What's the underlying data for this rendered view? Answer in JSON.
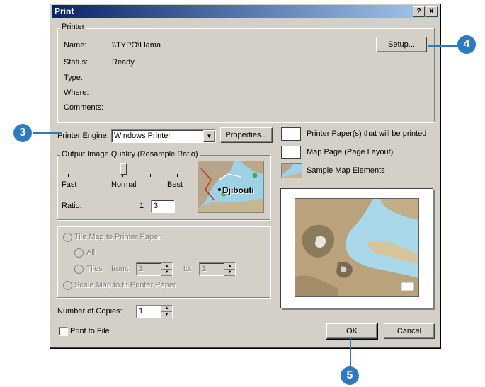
{
  "window": {
    "title": "Print",
    "help_btn": "?",
    "close_btn": "X"
  },
  "printer": {
    "group_title": "Printer",
    "name_label": "Name:",
    "name_value": "\\\\TYPO\\Llama",
    "status_label": "Status:",
    "status_value": "Ready",
    "type_label": "Type:",
    "where_label": "Where:",
    "comments_label": "Comments:",
    "setup_button": "Setup..."
  },
  "engine": {
    "label": "Printer Engine:",
    "value": "Windows Printer",
    "properties_button": "Properties..."
  },
  "quality": {
    "group_title": "Output Image Quality (Resample Ratio)",
    "fast": "Fast",
    "normal": "Normal",
    "best": "Best",
    "ratio_label": "Ratio:",
    "ratio_prefix": "1 :",
    "ratio_value": "3",
    "slider_position": 0.5,
    "preview_city": "Djibouti"
  },
  "tiling": {
    "tile_label": "Tile Map to Printer Paper",
    "all_label": "All",
    "tiles_label": "Tiles",
    "from_label": "from:",
    "from_value": "1",
    "to_label": "to:",
    "to_value": "1",
    "scale_label": "Scale Map to fit Printer Paper"
  },
  "copies": {
    "label": "Number of Copies:",
    "value": "1"
  },
  "print_to_file": {
    "label": "Print to File"
  },
  "legend": {
    "paper": "Printer Paper(s) that will be printed",
    "map_page": "Map Page (Page Layout)",
    "elements": "Sample Map Elements"
  },
  "buttons": {
    "ok": "OK",
    "cancel": "Cancel"
  },
  "callouts": {
    "c3": "3",
    "c4": "4",
    "c5": "5"
  },
  "colors": {
    "callout": "#2f7abf",
    "title_start": "#0a246a",
    "title_end": "#a6caf0"
  }
}
